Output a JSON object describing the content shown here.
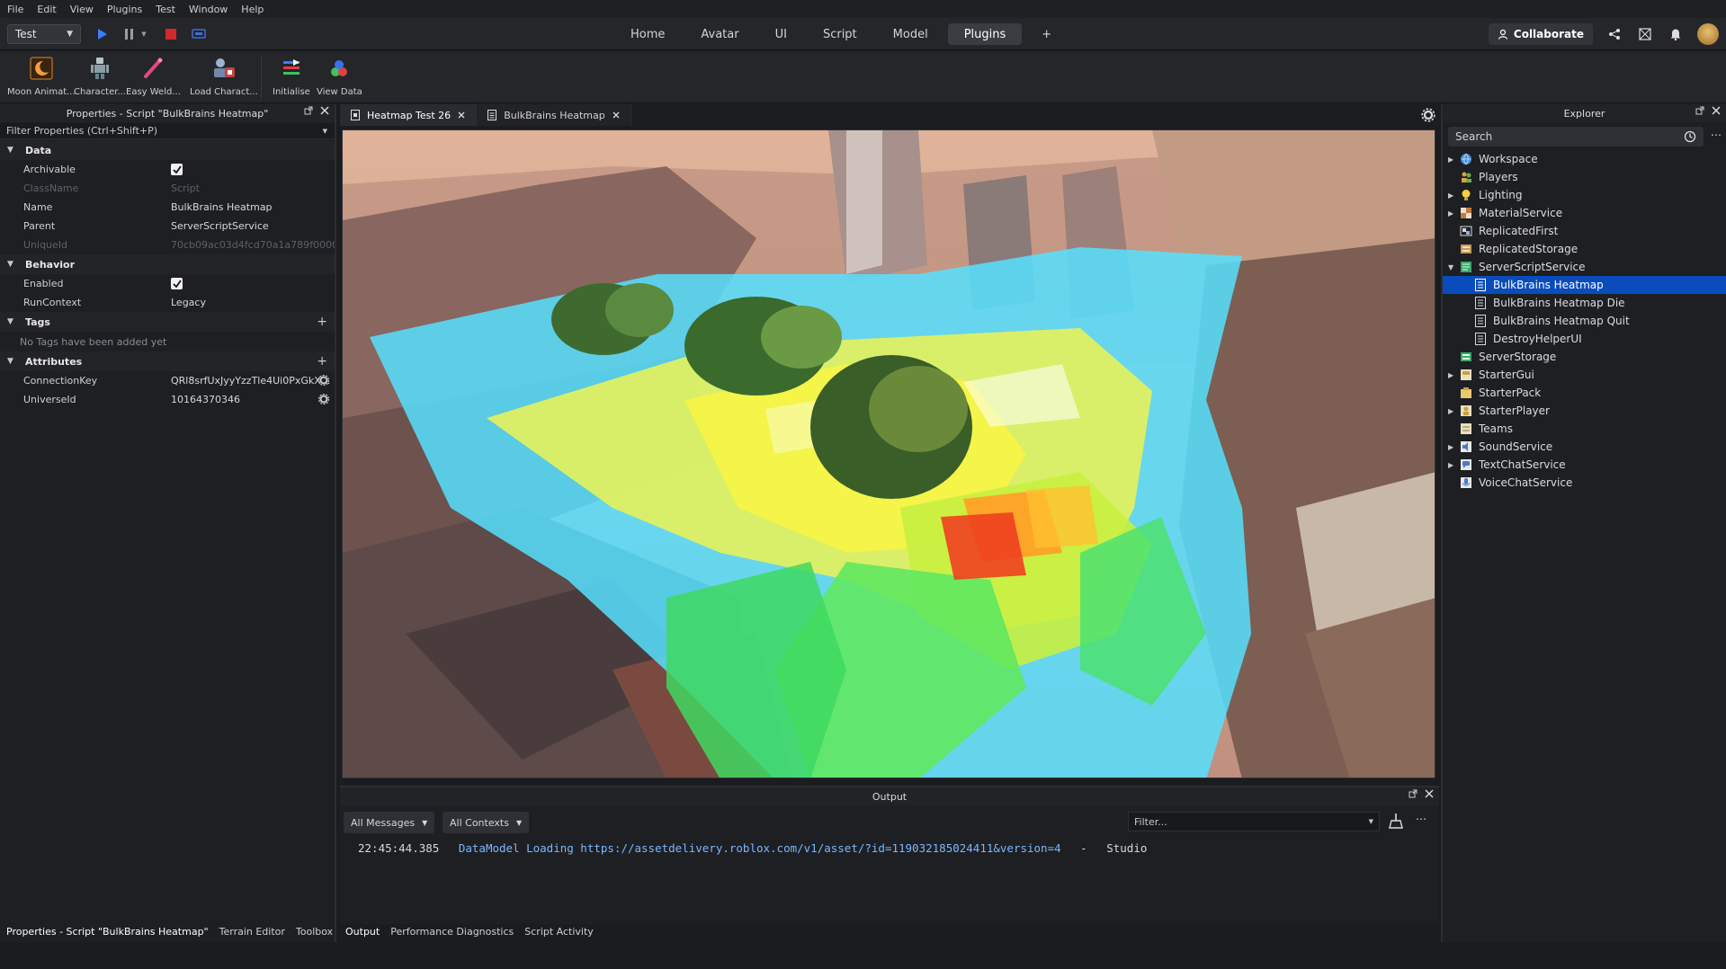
{
  "menu": [
    "File",
    "Edit",
    "View",
    "Plugins",
    "Test",
    "Window",
    "Help"
  ],
  "toolbar": {
    "mode_value": "Test",
    "tabs": [
      "Home",
      "Avatar",
      "UI",
      "Script",
      "Model",
      "Plugins",
      "+"
    ],
    "active_tab": "Plugins",
    "collaborate_label": "Collaborate"
  },
  "ribbon": {
    "items": [
      {
        "label": "Moon Animat...",
        "icon": "moon-icon"
      },
      {
        "label": "Character...",
        "icon": "character-icon"
      },
      {
        "label": "Easy Weld...",
        "icon": "weld-icon"
      },
      {
        "label": "Load Charact...",
        "icon": "load-character-icon"
      },
      {
        "label": "Initialise",
        "icon": "initialise-icon"
      },
      {
        "label": "View Data",
        "icon": "view-data-icon"
      }
    ]
  },
  "properties": {
    "title": "Properties - Script \"BulkBrains Heatmap\"",
    "filter_placeholder": "Filter Properties (Ctrl+Shift+P)",
    "sections": {
      "data": "Data",
      "behavior": "Behavior",
      "tags": "Tags",
      "attributes": "Attributes"
    },
    "rows": {
      "archivable": {
        "key": "Archivable",
        "checked": true
      },
      "classname": {
        "key": "ClassName",
        "value": "Script"
      },
      "name": {
        "key": "Name",
        "value": "BulkBrains Heatmap"
      },
      "parent": {
        "key": "Parent",
        "value": "ServerScriptService"
      },
      "uniqueid": {
        "key": "UniqueId",
        "value": "70cb09ac03d4fcd70a1a789f0000..."
      },
      "enabled": {
        "key": "Enabled",
        "checked": true
      },
      "runcontext": {
        "key": "RunContext",
        "value": "Legacy"
      },
      "connectionkey": {
        "key": "ConnectionKey",
        "value": "QRl8srfUxJyyYzzTle4Ui0PxGkX..."
      },
      "universeid": {
        "key": "UniverseId",
        "value": "10164370346"
      }
    },
    "no_tags": "No Tags have been added yet"
  },
  "left_bottom_tabs": [
    "Properties - Script \"BulkBrains Heatmap\"",
    "Terrain Editor",
    "Toolbox"
  ],
  "doc_tabs": [
    {
      "label": "Heatmap Test 26",
      "active": true
    },
    {
      "label": "BulkBrains Heatmap",
      "active": false
    }
  ],
  "output": {
    "title": "Output",
    "messages_filter": "All Messages",
    "contexts_filter": "All Contexts",
    "filter_placeholder": "Filter...",
    "log": {
      "time": "22:45:44.385",
      "message": "DataModel Loading https://assetdelivery.roblox.com/v1/asset/?id=119032185024411&version=4",
      "sep": "-",
      "source": "Studio"
    },
    "tabs": [
      "Output",
      "Performance Diagnostics",
      "Script Activity"
    ]
  },
  "explorer": {
    "title": "Explorer",
    "search_placeholder": "Search",
    "items": [
      {
        "label": "Workspace",
        "icon": "workspace-icon",
        "expandable": true
      },
      {
        "label": "Players",
        "icon": "players-icon",
        "expandable": false
      },
      {
        "label": "Lighting",
        "icon": "lighting-icon",
        "expandable": true
      },
      {
        "label": "MaterialService",
        "icon": "material-service-icon",
        "expandable": true
      },
      {
        "label": "ReplicatedFirst",
        "icon": "replicated-first-icon",
        "expandable": false
      },
      {
        "label": "ReplicatedStorage",
        "icon": "replicated-storage-icon",
        "expandable": false
      },
      {
        "label": "ServerScriptService",
        "icon": "server-script-service-icon",
        "expandable": true,
        "expanded": true
      },
      {
        "label": "BulkBrains Heatmap",
        "icon": "script-icon",
        "child": true,
        "selected": true
      },
      {
        "label": "BulkBrains Heatmap Die",
        "icon": "script-icon",
        "child": true
      },
      {
        "label": "BulkBrains Heatmap Quit",
        "icon": "script-icon",
        "child": true
      },
      {
        "label": "DestroyHelperUI",
        "icon": "script-icon",
        "child": true
      },
      {
        "label": "ServerStorage",
        "icon": "server-storage-icon",
        "expandable": false
      },
      {
        "label": "StarterGui",
        "icon": "starter-gui-icon",
        "expandable": true
      },
      {
        "label": "StarterPack",
        "icon": "starter-pack-icon",
        "expandable": false
      },
      {
        "label": "StarterPlayer",
        "icon": "starter-player-icon",
        "expandable": true
      },
      {
        "label": "Teams",
        "icon": "teams-icon",
        "expandable": false
      },
      {
        "label": "SoundService",
        "icon": "sound-service-icon",
        "expandable": true
      },
      {
        "label": "TextChatService",
        "icon": "text-chat-service-icon",
        "expandable": true
      },
      {
        "label": "VoiceChatService",
        "icon": "voice-chat-service-icon",
        "expandable": false
      }
    ]
  },
  "colors": {
    "accent": "#3d7bff",
    "selection": "#0b4cbd",
    "stop": "#d02a2a",
    "log_message": "#79b8ff"
  }
}
